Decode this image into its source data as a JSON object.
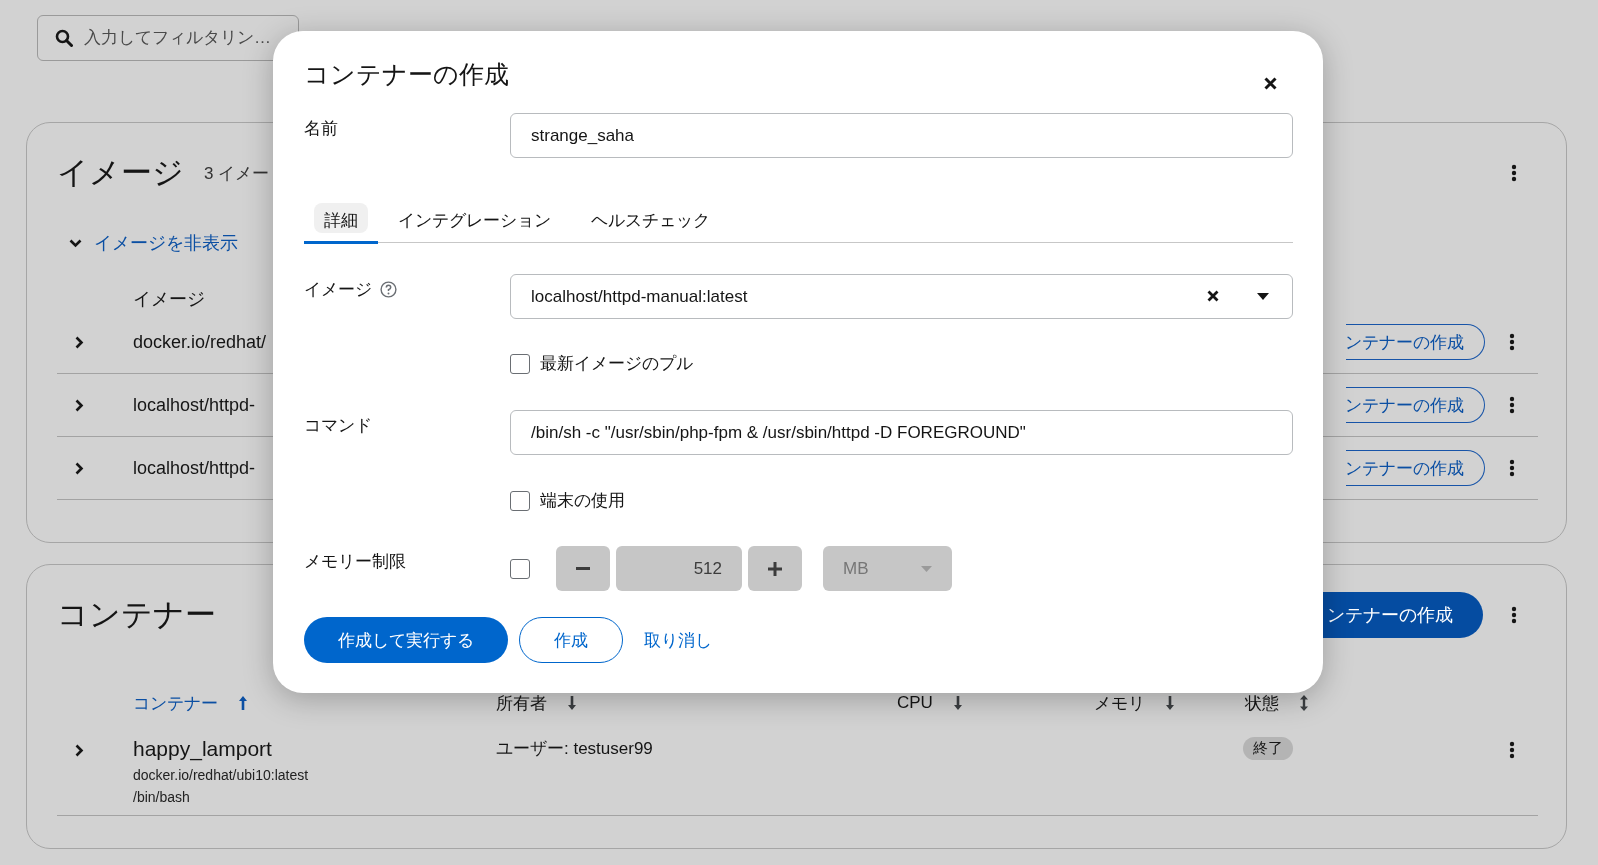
{
  "toolbar": {
    "filter_placeholder": "入力してフィルタリン…"
  },
  "images": {
    "title": "イメージ",
    "count": "3 イメー",
    "toggle": "イメージを非表示",
    "expanded": true,
    "column": "イメージ",
    "rows": [
      {
        "name": "docker.io/redhat/",
        "action": "ンテナーの作成"
      },
      {
        "name": "localhost/httpd-",
        "action": "ンテナーの作成"
      },
      {
        "name": "localhost/httpd-",
        "action": "ンテナーの作成"
      }
    ]
  },
  "containers": {
    "title": "コンテナー",
    "create_button": "ンテナーの作成",
    "columns": [
      {
        "label": "コンテナー",
        "kind": "ascending",
        "selected": true
      },
      {
        "label": "所有者",
        "kind": "descending",
        "selected": false
      },
      {
        "label": "CPU",
        "kind": "descending",
        "selected": false
      },
      {
        "label": "メモリ",
        "kind": "descending",
        "selected": false
      },
      {
        "label": "状態",
        "kind": "unsorted",
        "selected": false
      }
    ],
    "rows": [
      {
        "name": "happy_lamport",
        "image": "docker.io/redhat/ubi10:latest",
        "command": "/bin/bash",
        "owner": "ユーザー: testuser99",
        "status": "終了"
      }
    ]
  },
  "dialog": {
    "title": "コンテナーの作成",
    "name_label": "名前",
    "name_value": "strange_saha",
    "tabs": [
      {
        "label": "詳細",
        "selected": true
      },
      {
        "label": "インテグレーション",
        "selected": false
      },
      {
        "label": "ヘルスチェック",
        "selected": false
      }
    ],
    "image_label": "イメージ",
    "image_value": "localhost/httpd-manual:latest",
    "pull_latest": {
      "label": "最新イメージのプル",
      "checked": false
    },
    "command_label": "コマンド",
    "command_value": "/bin/sh -c \"/usr/sbin/php-fpm & /usr/sbin/httpd -D FOREGROUND\"",
    "terminal": {
      "label": "端末の使用",
      "checked": false
    },
    "memory": {
      "label": "メモリー制限",
      "checked": false,
      "value": "512",
      "unit": "MB"
    },
    "buttons": [
      {
        "label": "作成して実行する",
        "kind": "primary"
      },
      {
        "label": "作成",
        "kind": "secondary"
      },
      {
        "label": "取り消し",
        "kind": "link"
      }
    ]
  }
}
